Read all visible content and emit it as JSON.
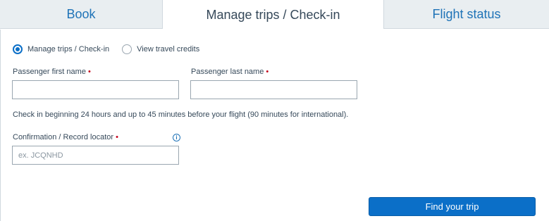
{
  "tabs": [
    {
      "label": "Book",
      "active": false
    },
    {
      "label": "Manage trips / Check-in",
      "active": true
    },
    {
      "label": "Flight status",
      "active": false
    }
  ],
  "radios": [
    {
      "label": "Manage trips / Check-in",
      "checked": true
    },
    {
      "label": "View travel credits",
      "checked": false
    }
  ],
  "fields": {
    "first_name": {
      "label": "Passenger first name",
      "required_marker": "•",
      "value": ""
    },
    "last_name": {
      "label": "Passenger last name",
      "required_marker": "•",
      "value": ""
    },
    "record_locator": {
      "label": "Confirmation / Record locator",
      "required_marker": "•",
      "value": "",
      "placeholder": "ex. JCQNHD"
    }
  },
  "note": "Check in beginning 24 hours and up to 45 minutes before your flight (90 minutes for international).",
  "info_icon": {
    "glyph": "i",
    "name": "info-icon"
  },
  "find_button": {
    "label": "Find your trip"
  },
  "colors": {
    "accent": "#0b6fc8",
    "required": "#c30019",
    "tab_inactive_bg": "#e9eef1",
    "text": "#36495a"
  }
}
